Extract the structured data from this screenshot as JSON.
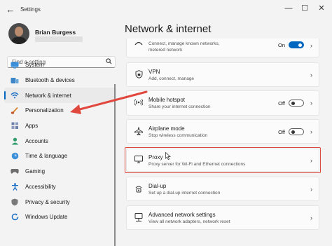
{
  "window": {
    "title": "Settings",
    "back_glyph": "←",
    "minimize_glyph": "—",
    "maximize_glyph": "☐",
    "close_glyph": "✕"
  },
  "user": {
    "name": "Brian Burgess"
  },
  "search": {
    "placeholder": "Find a setting",
    "icon": "search-icon"
  },
  "nav": {
    "items": [
      {
        "label": "System",
        "icon": "monitor-icon"
      },
      {
        "label": "Bluetooth & devices",
        "icon": "bluetooth-icon"
      },
      {
        "label": "Network & internet",
        "icon": "wifi-icon",
        "selected": true
      },
      {
        "label": "Personalization",
        "icon": "brush-icon"
      },
      {
        "label": "Apps",
        "icon": "apps-icon"
      },
      {
        "label": "Accounts",
        "icon": "person-icon"
      },
      {
        "label": "Time & language",
        "icon": "globe-clock-icon"
      },
      {
        "label": "Gaming",
        "icon": "controller-icon"
      },
      {
        "label": "Accessibility",
        "icon": "accessibility-icon"
      },
      {
        "label": "Privacy & security",
        "icon": "shield-icon"
      },
      {
        "label": "Windows Update",
        "icon": "update-icon"
      }
    ]
  },
  "page": {
    "title": "Network & internet"
  },
  "cards": {
    "wifi": {
      "subtitle_1": "Connect, manage known networks,",
      "subtitle_2": "metered network",
      "state": "On",
      "toggle_on": true
    },
    "vpn": {
      "title": "VPN",
      "subtitle": "Add, connect, manage"
    },
    "hotspot": {
      "title": "Mobile hotspot",
      "subtitle": "Share your internet connection",
      "state": "Off",
      "toggle_on": false
    },
    "airplane": {
      "title": "Airplane mode",
      "subtitle": "Stop wireless communication",
      "state": "Off",
      "toggle_on": false
    },
    "proxy": {
      "title": "Proxy",
      "subtitle": "Proxy server for Wi-Fi and Ethernet connections"
    },
    "dialup": {
      "title": "Dial-up",
      "subtitle": "Set up a dial-up internet connection"
    },
    "advanced": {
      "title": "Advanced network settings",
      "subtitle": "View all network adapters, network reset"
    }
  },
  "colors": {
    "accent": "#0067c0",
    "annotation": "#e0473d",
    "background": "#f3f3f3"
  }
}
